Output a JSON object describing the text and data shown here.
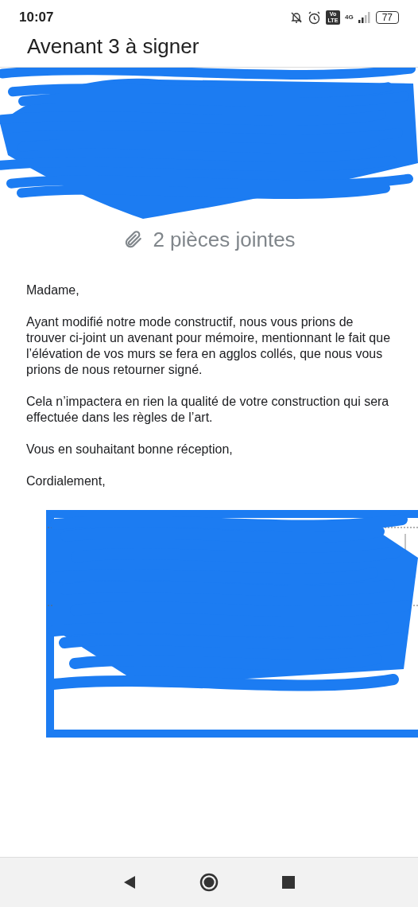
{
  "status_bar": {
    "time": "10:07",
    "network": "4G",
    "volte": "Vo LTE",
    "battery": "77"
  },
  "message": {
    "subject": "Avenant 3 à signer",
    "attachments": "2 pièces jointes",
    "body": [
      "Madame,",
      "Ayant modifié notre mode constructif, nous vous prions de trouver ci-joint un avenant pour mémoire, mentionnant le fait que l’élévation de vos murs se fera en agglos collés, que nous vous prions de nous retourner signé.",
      "Cela n’impactera en rien la qualité de votre construction qui sera effectuée dans les règles de l’art.",
      "Vous en souhaitant bonne réception,",
      "Cordialement,"
    ]
  }
}
